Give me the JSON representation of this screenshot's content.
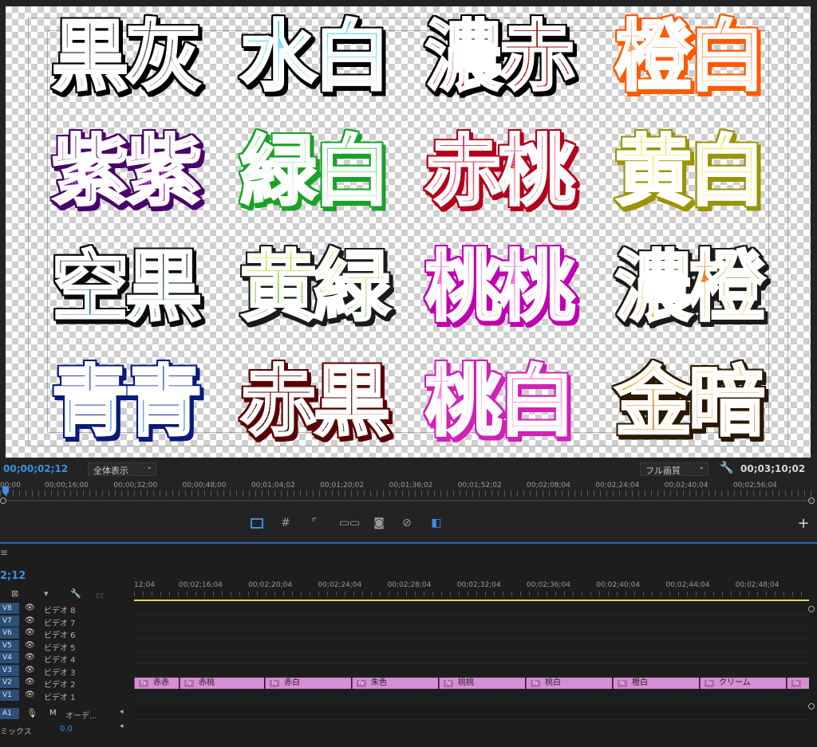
{
  "words": [
    {
      "text": "黒灰",
      "grad": [
        "#111111",
        "#bbbbbb"
      ],
      "stroke": "#ffffff",
      "outer": "#000000"
    },
    {
      "text": "水白",
      "grad": [
        "#2ec9f0",
        "#ffffff"
      ],
      "stroke": "#ffffff",
      "outer": "#000000"
    },
    {
      "text": "濃赤",
      "grad": [
        "#6e0000",
        "#e0151d"
      ],
      "stroke": "#ffffff",
      "outer": "#000000"
    },
    {
      "text": "橙白",
      "grad": [
        "#ff6a1a",
        "#ffe7d6"
      ],
      "stroke": "#ffffff",
      "outer": "#ff5a00"
    },
    {
      "text": "紫紫",
      "grad": [
        "#3b0a5a",
        "#b21bd6"
      ],
      "stroke": "#ffffff",
      "outer": "#4a006a"
    },
    {
      "text": "緑白",
      "grad": [
        "#27d33a",
        "#e9ffe8"
      ],
      "stroke": "#ffffff",
      "outer": "#1aa12a"
    },
    {
      "text": "赤桃",
      "grad": [
        "#d5102a",
        "#ff7fa0"
      ],
      "stroke": "#ffffff",
      "outer": "#b2001d"
    },
    {
      "text": "黄白",
      "grad": [
        "#e6e02a",
        "#fffdd8"
      ],
      "stroke": "#ffffff",
      "outer": "#9a9400"
    },
    {
      "text": "空黒",
      "grad": [
        "#0a0a0a",
        "#1e8fb0"
      ],
      "stroke": "#ffffff",
      "outer": "#0a0a0a"
    },
    {
      "text": "黄緑",
      "grad": [
        "#d8ea12",
        "#16b424"
      ],
      "stroke": "#ffffff",
      "outer": "#1a1a1a"
    },
    {
      "text": "桃桃",
      "grad": [
        "#e02bd0",
        "#ffb4f1"
      ],
      "stroke": "#ffffff",
      "outer": "#c000b0"
    },
    {
      "text": "濃橙",
      "grad": [
        "#d35800",
        "#ffbd10"
      ],
      "stroke": "#ffffff",
      "outer": "#1a1a1a"
    },
    {
      "text": "青青",
      "grad": [
        "#1236c4",
        "#2b8ff0"
      ],
      "stroke": "#ffffff",
      "outer": "#0a1a7a"
    },
    {
      "text": "赤黒",
      "grad": [
        "#9e0a0a",
        "#0c0000"
      ],
      "stroke": "#ffffff",
      "outer": "#5a0000"
    },
    {
      "text": "桃白",
      "grad": [
        "#f04bd8",
        "#ffe6fb"
      ],
      "stroke": "#ffffff",
      "outer": "#d220b8"
    },
    {
      "text": "金暗",
      "grad": [
        "#f9d13a",
        "#c06510"
      ],
      "stroke": "#ffffff",
      "outer": "#2a1800"
    }
  ],
  "program_monitor": {
    "timecode_current": "00;00;02;12",
    "zoom_label": "全体表示",
    "quality_label": "フル画質",
    "timecode_duration": "00;03;10;02",
    "ruler_labels": [
      "00;00",
      "00;00;16;00",
      "00;00;32;00",
      "00;00;48;00",
      "00;01;04;02",
      "00;01;20;02",
      "00;01;36;02",
      "00;01;52;02",
      "00;02;08;04",
      "00;02;24;04",
      "00;02;40;04",
      "00;02;56;04"
    ]
  },
  "timeline": {
    "menu_icon": "≡",
    "timecode": "2;12",
    "ruler_labels": [
      "12;04",
      "00;02;16;04",
      "00;02;20;04",
      "00;02;24;04",
      "00;02;28;04",
      "00;02;32;04",
      "00;02;36;04",
      "00;02;40;04",
      "00;02;44;04",
      "00;02;48;04"
    ],
    "video_tracks": [
      {
        "id": "V8",
        "name": "ビデオ 8"
      },
      {
        "id": "V7",
        "name": "ビデオ 7"
      },
      {
        "id": "V6",
        "name": "ビデオ 6"
      },
      {
        "id": "V5",
        "name": "ビデオ 5"
      },
      {
        "id": "V4",
        "name": "ビデオ 4"
      },
      {
        "id": "V3",
        "name": "ビデオ 3"
      },
      {
        "id": "V2",
        "name": "ビデオ 2"
      },
      {
        "id": "V1",
        "name": "ビデオ 1"
      }
    ],
    "audio_track": {
      "id": "A1",
      "m_label": "M",
      "name": "オーデ..."
    },
    "mix_label": "ミックス",
    "mix_value": "0.0",
    "clips": [
      "赤赤",
      "赤桃",
      "赤白",
      "朱色",
      "桃桃",
      "桃白",
      "橙白",
      "クリーム"
    ],
    "clip_fx_label": "fx"
  }
}
